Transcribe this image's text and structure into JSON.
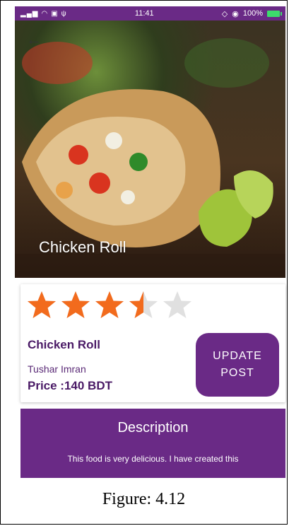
{
  "status_bar": {
    "time": "11:41",
    "battery_percent": "100%"
  },
  "hero": {
    "title": "Chicken Roll"
  },
  "rating": {
    "value": 3.5,
    "max": 5,
    "filled_color": "#f26b1d",
    "empty_color": "#e0e0e0"
  },
  "item": {
    "name": "Chicken Roll",
    "author": "Tushar Imran",
    "price": "Price :140 BDT"
  },
  "update_button": {
    "label": "UPDATE\nPOST"
  },
  "description": {
    "heading": "Description",
    "text": "This food is very delicious. I have created this"
  },
  "caption": "Figure: 4.12",
  "colors": {
    "accent": "#6a2a86"
  }
}
